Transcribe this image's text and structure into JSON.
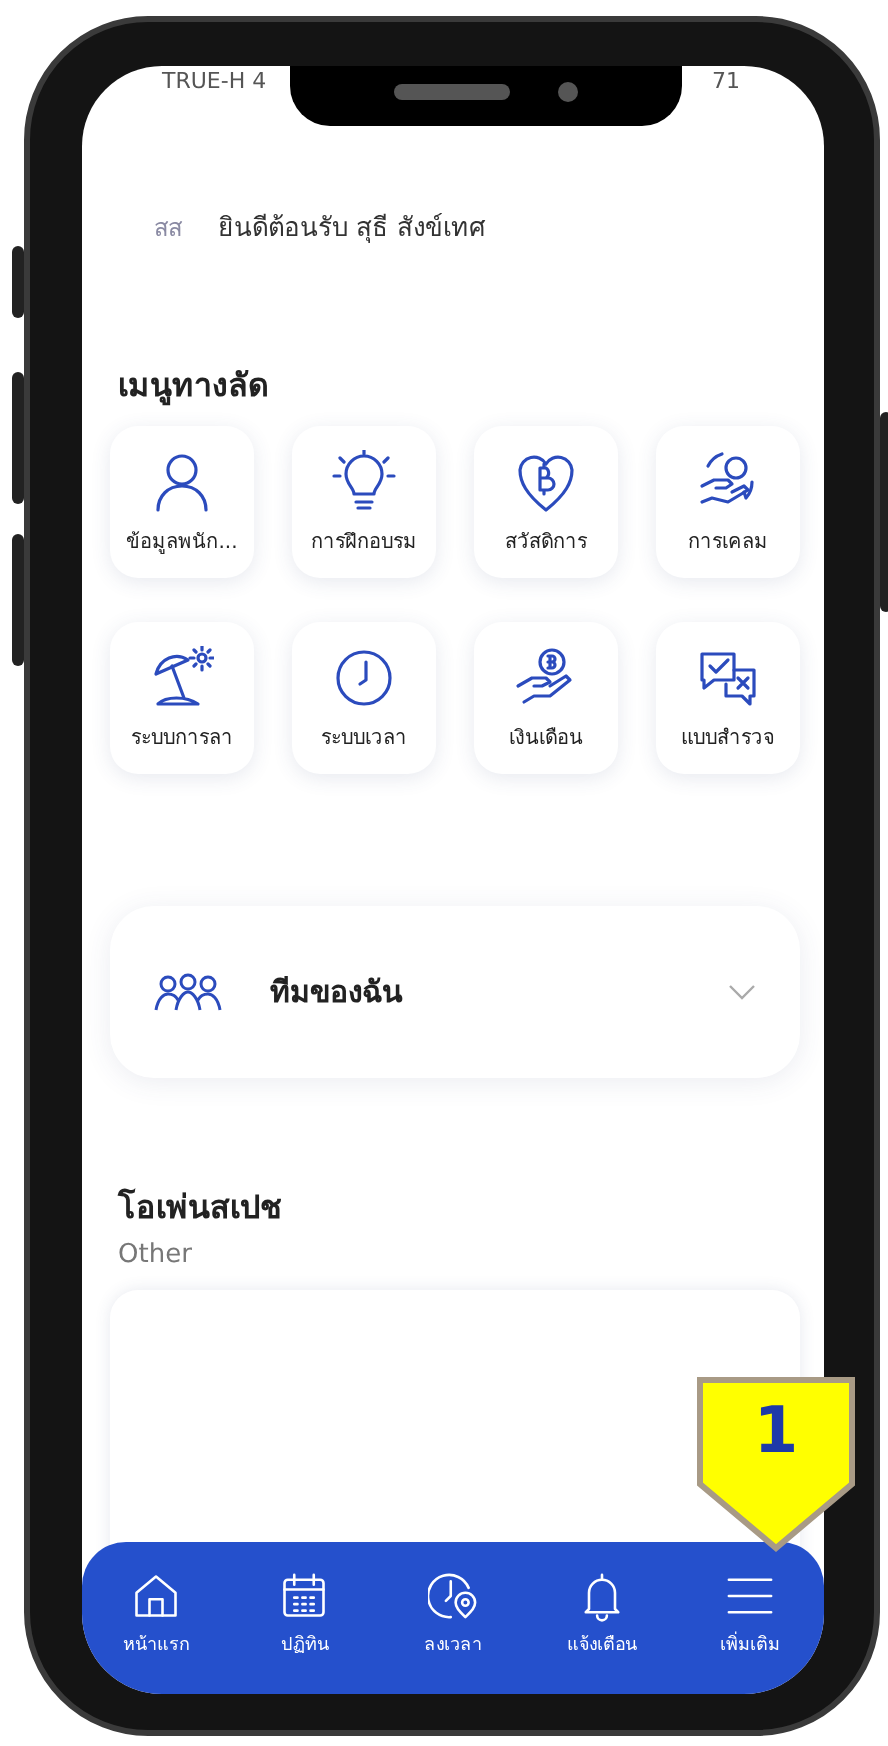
{
  "status_bar": {
    "carrier": "TRUE-H 4",
    "battery": "71"
  },
  "greeting": {
    "initials": "สส",
    "text": "ยินดีต้อนรับ สุธี สังข์เทศ"
  },
  "shortcuts": {
    "title": "เมนูทางลัด",
    "items": [
      {
        "label": "ข้อมูลพนัก..."
      },
      {
        "label": "การฝึกอบรม"
      },
      {
        "label": "สวัสดิการ"
      },
      {
        "label": "การเคลม"
      },
      {
        "label": "ระบบการลา"
      },
      {
        "label": "ระบบเวลา"
      },
      {
        "label": "เงินเดือน"
      },
      {
        "label": "แบบสำรวจ"
      }
    ]
  },
  "team_card": {
    "label": "ทีมของฉัน",
    "expanded": false
  },
  "open_space": {
    "title": "โอเพ่นสเปช",
    "subtitle": "Other"
  },
  "bottom_nav": [
    {
      "label": "หน้าแรก"
    },
    {
      "label": "ปฏิทิน"
    },
    {
      "label": "ลงเวลา"
    },
    {
      "label": "แจ้งเตือน"
    },
    {
      "label": "เพิ่มเติม"
    }
  ],
  "callout": {
    "number": "1"
  }
}
